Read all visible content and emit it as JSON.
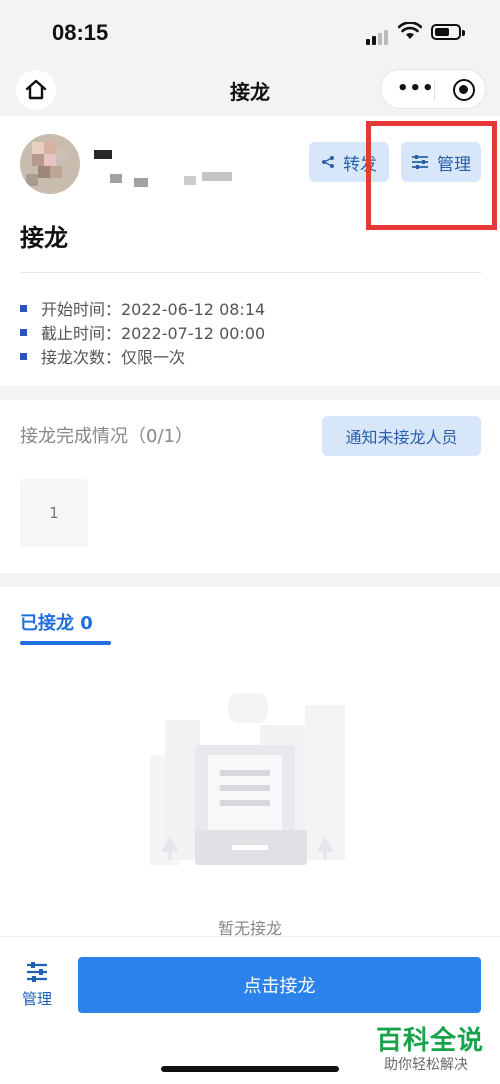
{
  "status_bar": {
    "time": "08:15"
  },
  "nav": {
    "title": "接龙"
  },
  "header": {
    "share_label": "转发",
    "manage_label": "管理",
    "title": "接龙"
  },
  "info": [
    {
      "label": "开始时间：2022-06-12 08:14"
    },
    {
      "label": "截止时间：2022-07-12 00:00"
    },
    {
      "label": "接龙次数：仅限一次"
    }
  ],
  "completion": {
    "label": "接龙完成情况（0/1）",
    "notify_label": "通知未接龙人员",
    "slot_number": "1"
  },
  "tabs": {
    "joined_label": "已接龙 0"
  },
  "empty_state": {
    "text": "暂无接龙"
  },
  "bottom": {
    "manage_label": "管理",
    "submit_label": "点击接龙"
  },
  "watermark": {
    "main": "百科全说",
    "sub": "助你轻松解决"
  },
  "colors": {
    "accent": "#2b82ea",
    "accent_light": "#d7e6f8",
    "highlight": "#e53935"
  }
}
